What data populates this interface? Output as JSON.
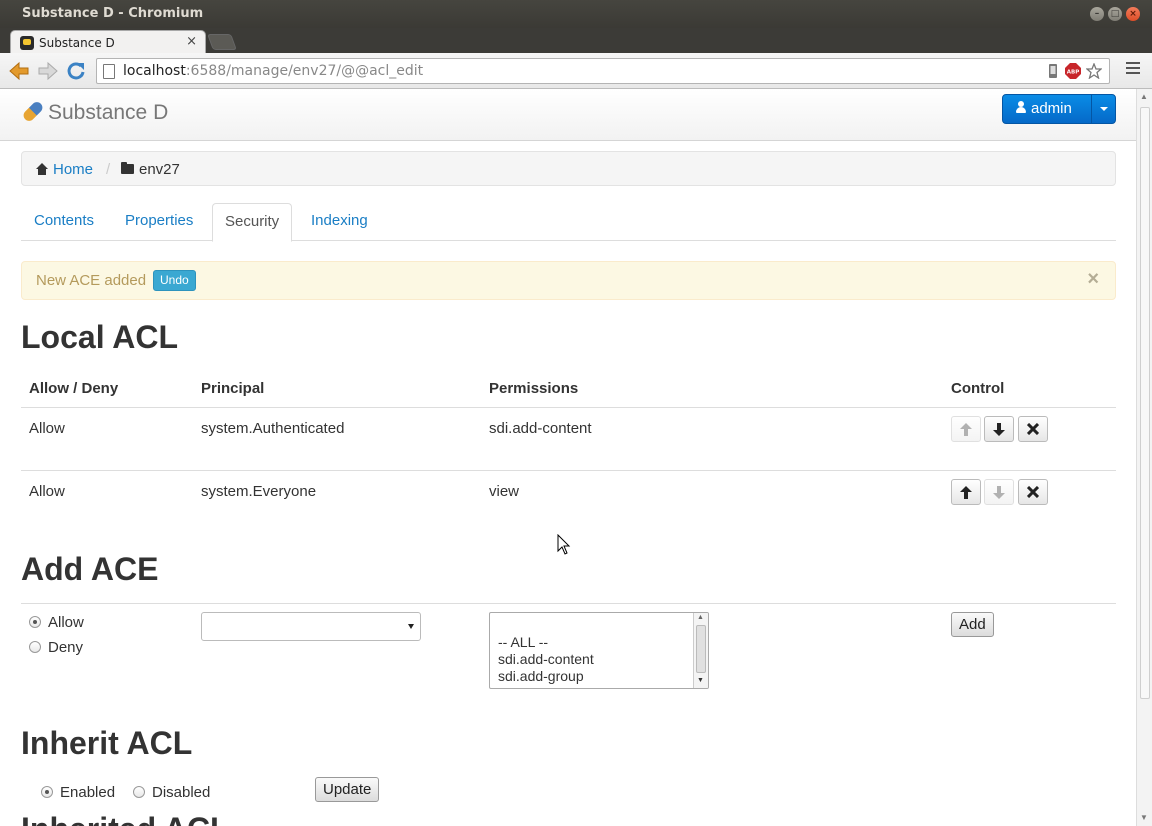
{
  "window": {
    "title": "Substance D - Chromium"
  },
  "browser": {
    "tab_title": "Substance D",
    "tab_close": "×",
    "url_host": "localhost",
    "url_rest": ":6588/manage/env27/@@acl_edit"
  },
  "navbar": {
    "brand": "Substance D",
    "user": "admin"
  },
  "breadcrumb": {
    "home": "Home",
    "separator": "/",
    "current": "env27"
  },
  "tabs": {
    "contents": "Contents",
    "properties": "Properties",
    "security": "Security",
    "indexing": "Indexing"
  },
  "alert": {
    "message": "New ACE added",
    "undo": "Undo",
    "close": "×"
  },
  "local_acl": {
    "heading": "Local ACL",
    "columns": {
      "allow_deny": "Allow / Deny",
      "principal": "Principal",
      "permissions": "Permissions",
      "control": "Control"
    },
    "rows": [
      {
        "action": "Allow",
        "principal": "system.Authenticated",
        "permissions": "sdi.add-content"
      },
      {
        "action": "Allow",
        "principal": "system.Everyone",
        "permissions": "view"
      }
    ]
  },
  "add_ace": {
    "heading": "Add ACE",
    "allow": "Allow",
    "deny": "Deny",
    "permission_options": [
      "-- ALL --",
      "sdi.add-content",
      "sdi.add-group"
    ],
    "add_button": "Add"
  },
  "inherit_acl": {
    "heading": "Inherit ACL",
    "enabled": "Enabled",
    "disabled": "Disabled",
    "update_button": "Update"
  },
  "inherited_acl": {
    "heading": "Inherited ACL"
  }
}
